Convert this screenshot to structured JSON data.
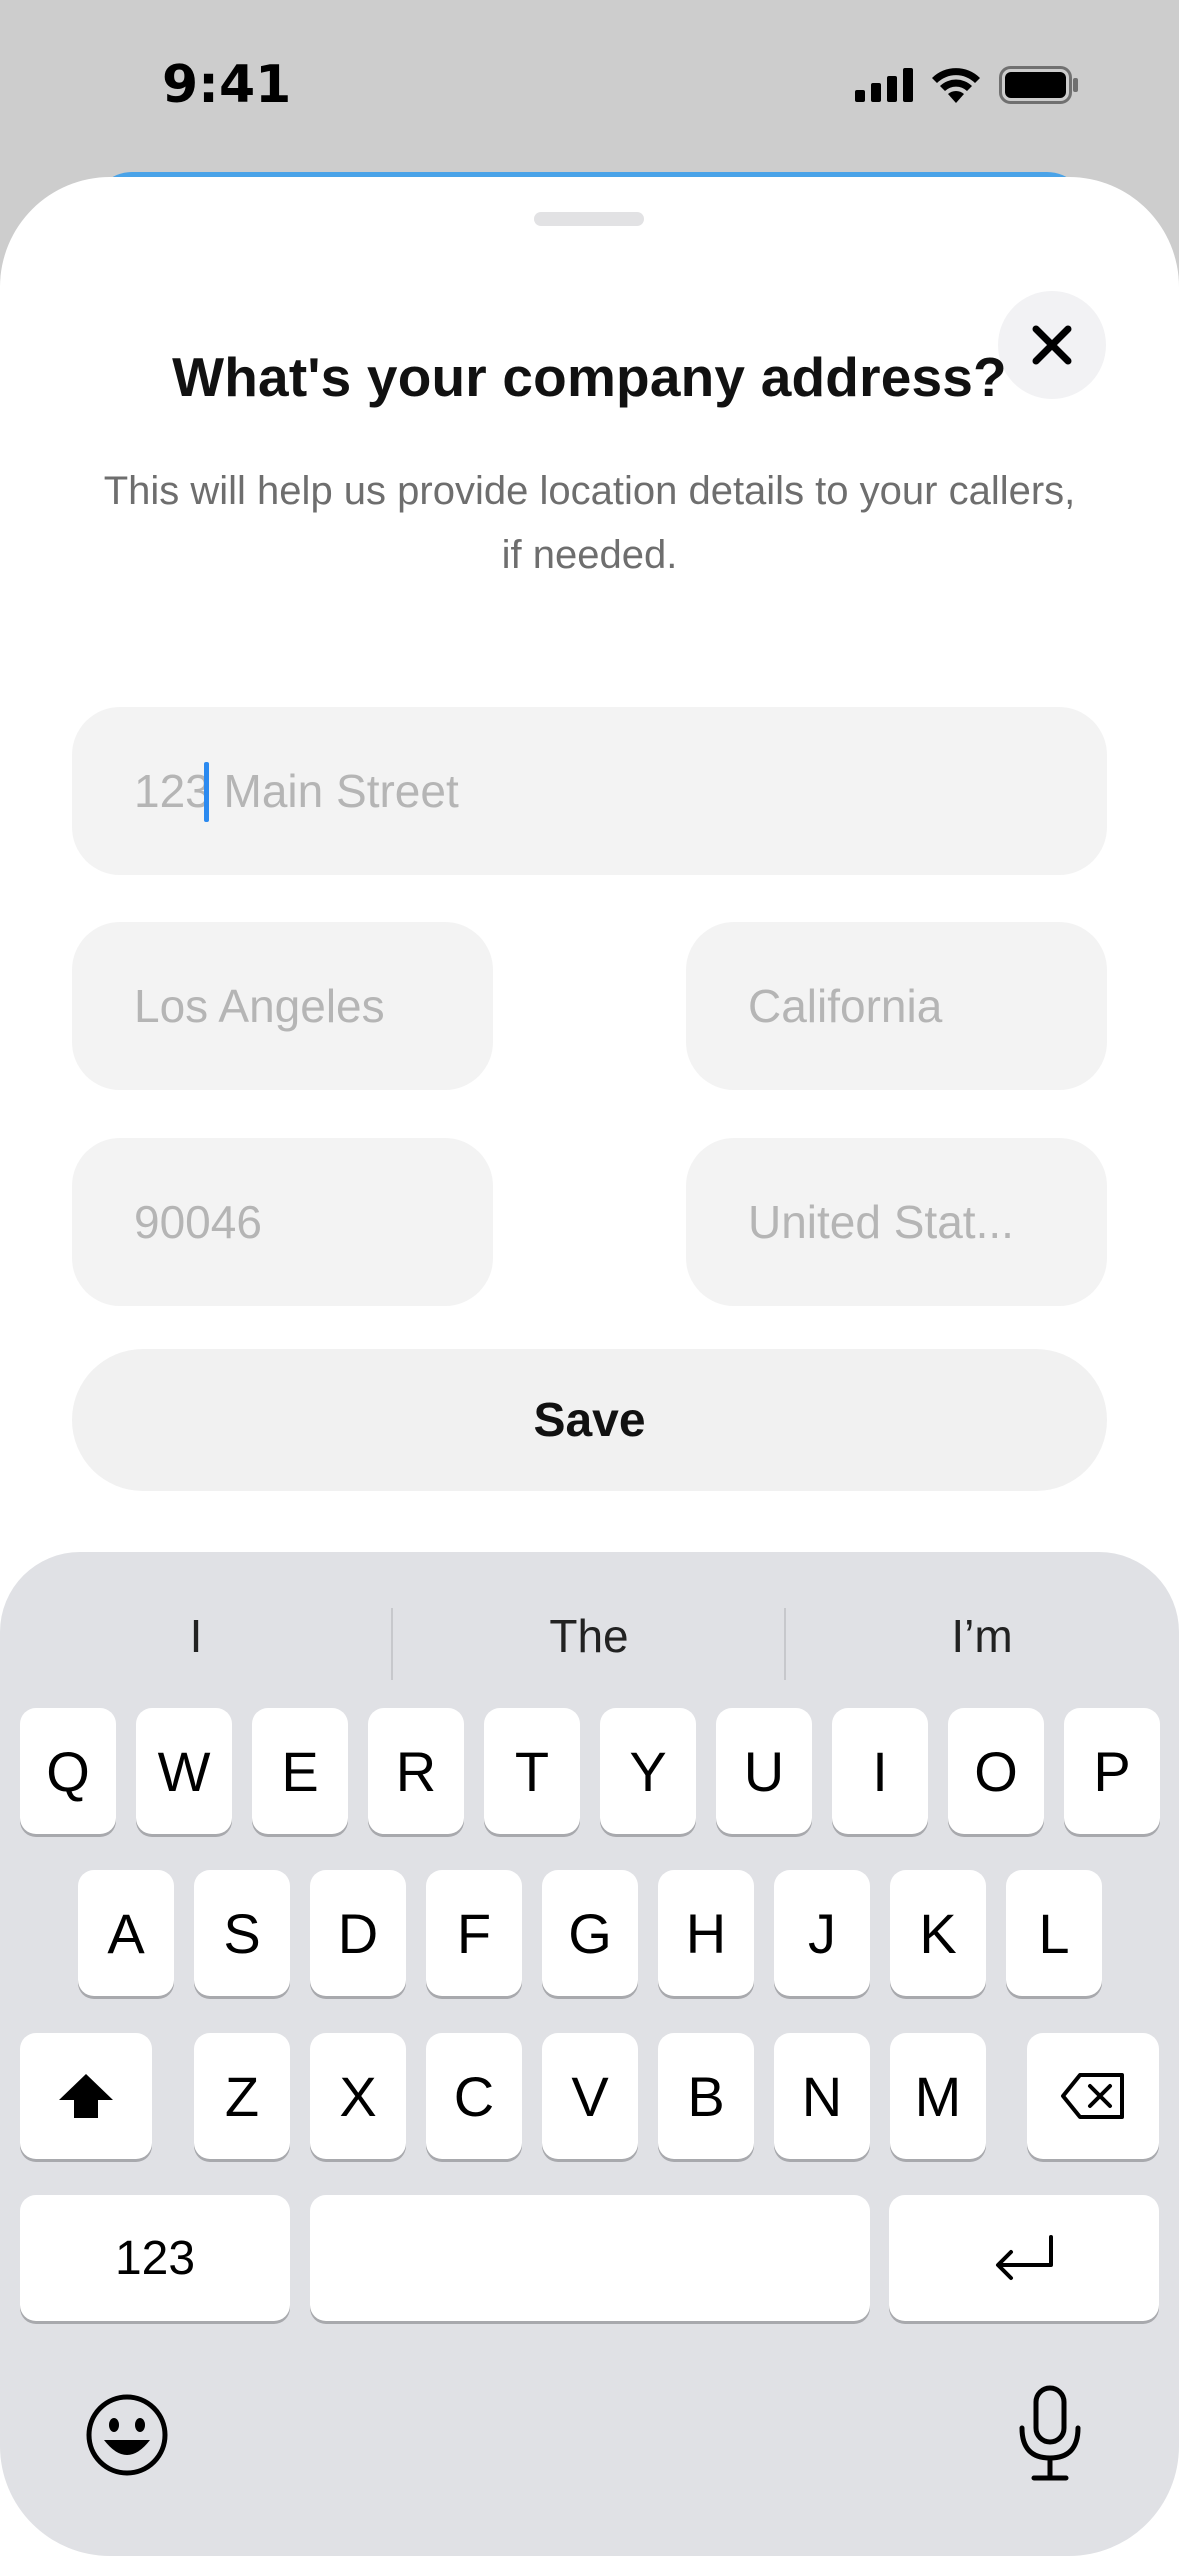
{
  "status_bar": {
    "time": "9:41"
  },
  "sheet": {
    "title": "What's your company address?",
    "subtitle": "This will help us provide location details to your callers, if needed."
  },
  "form": {
    "street_placeholder": "123 Main Street",
    "city_placeholder": "Los Angeles",
    "state_placeholder": "California",
    "zip_placeholder": "90046",
    "country_placeholder": "United Stat...",
    "save_label": "Save"
  },
  "keyboard": {
    "suggestions": [
      "I",
      "The",
      "I’m"
    ],
    "row1": [
      "Q",
      "W",
      "E",
      "R",
      "T",
      "Y",
      "U",
      "I",
      "O",
      "P"
    ],
    "row2": [
      "A",
      "S",
      "D",
      "F",
      "G",
      "H",
      "J",
      "K",
      "L"
    ],
    "row3": [
      "Z",
      "X",
      "C",
      "V",
      "B",
      "N",
      "M"
    ],
    "numbers_label": "123"
  }
}
